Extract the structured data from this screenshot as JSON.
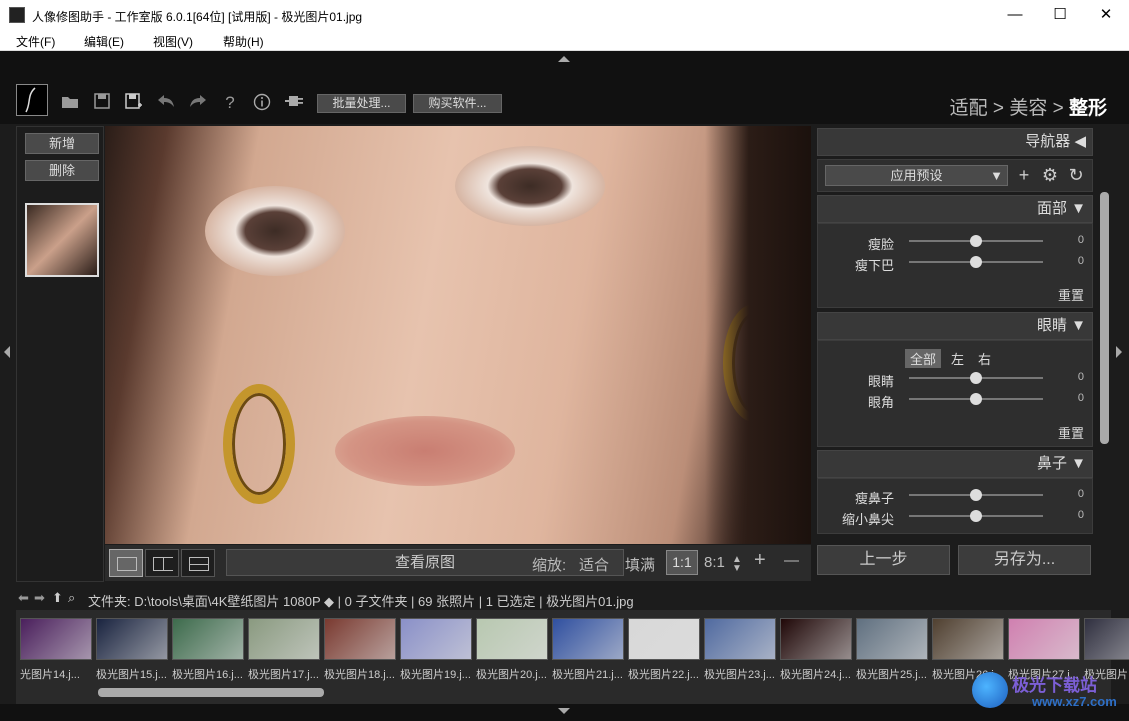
{
  "window": {
    "title": "人像修图助手 - 工作室版 6.0.1[64位] [试用版] - 极光图片01.jpg",
    "minimize": "—",
    "maximize": "☐",
    "close": "✕"
  },
  "menu": [
    "文件(F)",
    "编辑(E)",
    "视图(V)",
    "帮助(H)"
  ],
  "toolbar": {
    "batch_label": "批量处理...",
    "buy_label": "购买软件...",
    "icons": [
      "open-folder-icon",
      "save-icon",
      "save-as-icon",
      "undo-icon",
      "redo-icon",
      "help-icon",
      "info-icon",
      "plugin-icon"
    ]
  },
  "breadcrumb": {
    "step1": "适配",
    "sep1": " > ",
    "step2": "美容",
    "sep2": " > ",
    "step3": "整形"
  },
  "left_panel": {
    "add_label": "新增",
    "delete_label": "删除"
  },
  "viewbar": {
    "compare_label": "查看原图",
    "zoom_label": "缩放:",
    "fit_label": "适合",
    "fill_label": "填满",
    "z1_label": "1:1",
    "z8_label": "8:1",
    "plus": "+",
    "minus": "—"
  },
  "right_panel": {
    "navigator": "导航器 ◀",
    "preset": "应用预设",
    "face": {
      "title": "面部 ▼",
      "sliders": [
        {
          "label": "瘦脸",
          "value": "0",
          "level": 0.5
        },
        {
          "label": "瘦下巴",
          "value": "0",
          "level": 0.5
        }
      ],
      "reset": "重置"
    },
    "eyes": {
      "title": "眼睛 ▼",
      "seg": [
        "全部",
        "左",
        "右"
      ],
      "sliders": [
        {
          "label": "眼睛",
          "value": "0",
          "level": 0.5
        },
        {
          "label": "眼角",
          "value": "0",
          "level": 0.5
        }
      ],
      "reset": "重置"
    },
    "nose": {
      "title": "鼻子 ▼",
      "sliders": [
        {
          "label": "瘦鼻子",
          "value": "0",
          "level": 0.5
        },
        {
          "label": "缩小鼻尖",
          "value": "0",
          "level": 0.5
        }
      ]
    },
    "prev_label": "上一步",
    "saveas_label": "另存为..."
  },
  "pathbar": {
    "text": "文件夹:  D:\\tools\\桌面\\4K壁纸图片 1080P ◆ | 0 子文件夹 | 69 张照片 | 1 已选定 | 极光图片01.jpg"
  },
  "filmstrip": [
    {
      "caption": "光图片14.j...",
      "color": "#4a1f5c"
    },
    {
      "caption": "极光图片15.j...",
      "color": "#1a2440"
    },
    {
      "caption": "极光图片16.j...",
      "color": "#3d6b4c"
    },
    {
      "caption": "极光图片17.j...",
      "color": "#8a9a80"
    },
    {
      "caption": "极光图片18.j...",
      "color": "#7a3a30"
    },
    {
      "caption": "极光图片19.j...",
      "color": "#8a90c8"
    },
    {
      "caption": "极光图片20.j...",
      "color": "#b8c8b0"
    },
    {
      "caption": "极光图片21.j...",
      "color": "#3050a0"
    },
    {
      "caption": "极光图片22.j...",
      "color": "#d8d8d8"
    },
    {
      "caption": "极光图片23.j...",
      "color": "#506aa0"
    },
    {
      "caption": "极光图片24.j...",
      "color": "#200808"
    },
    {
      "caption": "极光图片25.j...",
      "color": "#607080"
    },
    {
      "caption": "极光图片26.j...",
      "color": "#504030"
    },
    {
      "caption": "极光图片27.j...",
      "color": "#d080b0"
    },
    {
      "caption": "极光图片...",
      "color": "#303040"
    }
  ],
  "watermark": {
    "line1": "极光下载站",
    "line2": "www.xz7.com"
  }
}
